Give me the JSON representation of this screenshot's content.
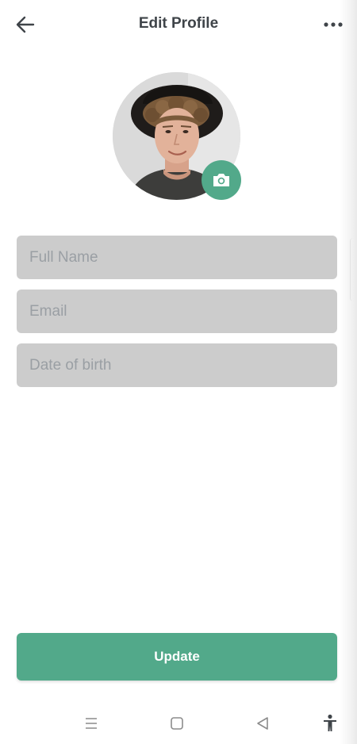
{
  "header": {
    "title": "Edit Profile",
    "back_icon": "arrow-left-icon",
    "more_icon": "more-horizontal-icon"
  },
  "profile": {
    "camera_icon": "camera-icon"
  },
  "form": {
    "full_name_placeholder": "Full Name",
    "full_name_value": "",
    "email_placeholder": "Email",
    "email_value": "",
    "dob_placeholder": "Date of birth",
    "dob_value": ""
  },
  "actions": {
    "update_label": "Update"
  },
  "system_nav": {
    "items": [
      "menu-icon",
      "home-icon",
      "back-icon",
      "accessibility-icon"
    ]
  },
  "colors": {
    "accent": "#52a98a",
    "field_bg": "#cccccc",
    "title": "#3f4449",
    "placeholder": "#9a9fa4"
  }
}
